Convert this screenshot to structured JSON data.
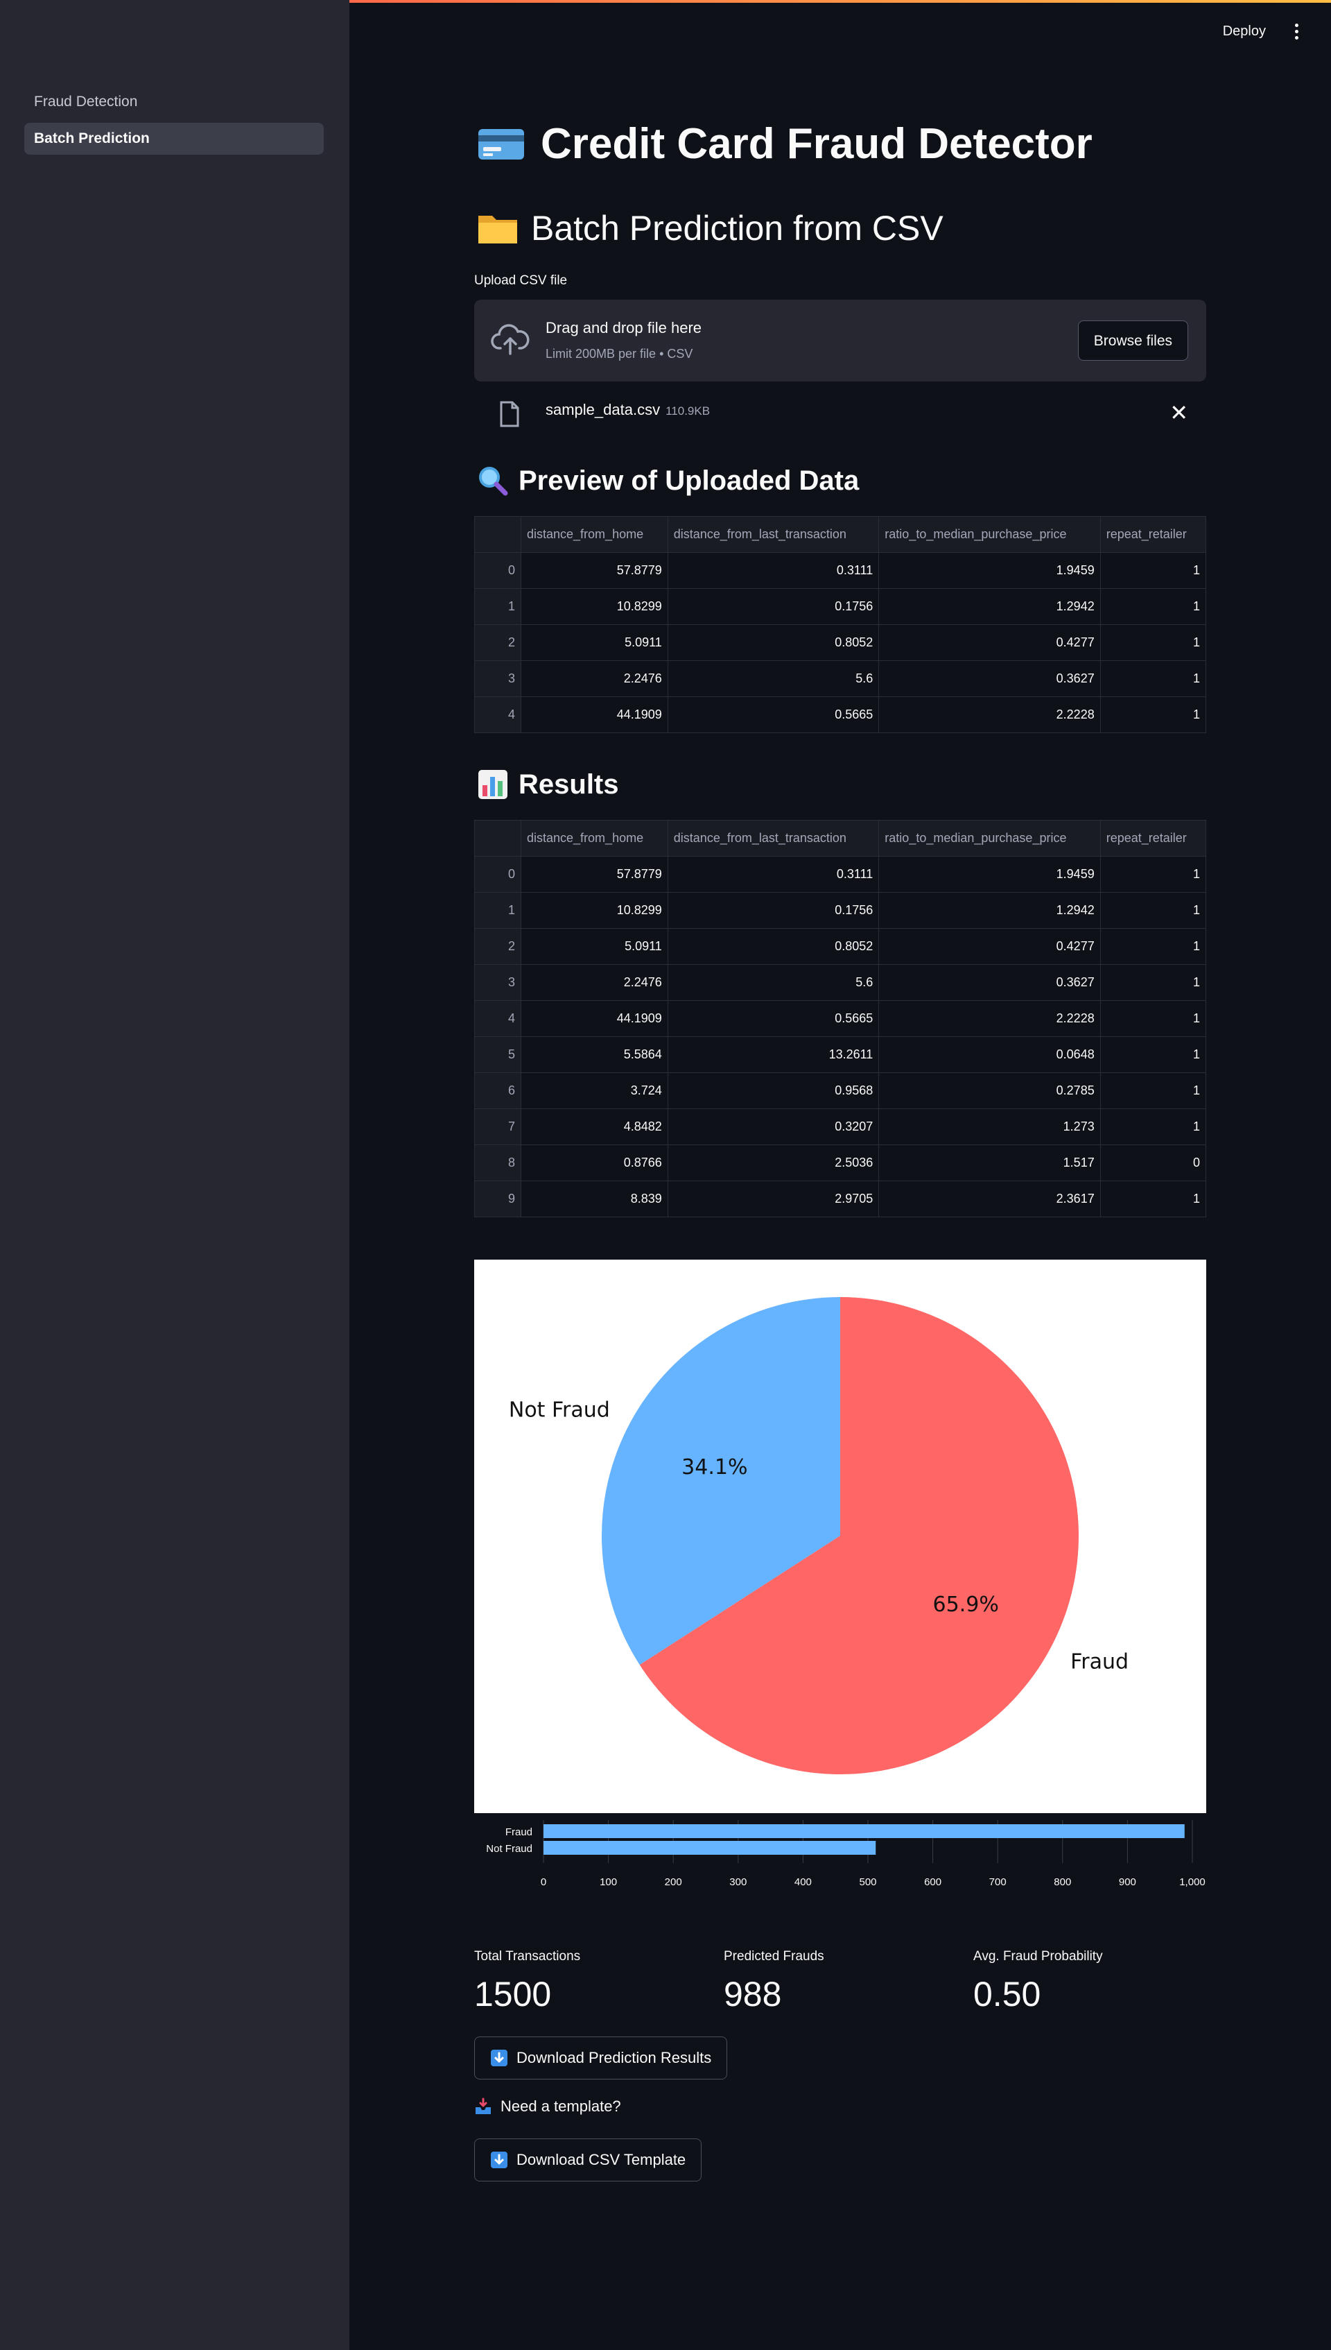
{
  "sidebar": {
    "items": [
      {
        "label": "Fraud Detection",
        "active": false
      },
      {
        "label": "Batch Prediction",
        "active": true
      }
    ]
  },
  "header": {
    "deploy_label": "Deploy",
    "menu_icon": "kebab-menu-icon"
  },
  "title": "Credit Card Fraud Detector",
  "subtitle": "Batch Prediction from CSV",
  "uploader": {
    "label": "Upload CSV file",
    "drop_text": "Drag and drop file here",
    "limit_text": "Limit 200MB per file • CSV",
    "browse_label": "Browse files",
    "file_name": "sample_data.csv",
    "file_size": "110.9KB"
  },
  "preview": {
    "heading": "Preview of Uploaded Data",
    "columns": [
      "",
      "distance_from_home",
      "distance_from_last_transaction",
      "ratio_to_median_purchase_price",
      "repeat_retailer"
    ],
    "rows": [
      [
        "0",
        "57.8779",
        "0.3111",
        "1.9459",
        "1"
      ],
      [
        "1",
        "10.8299",
        "0.1756",
        "1.2942",
        "1"
      ],
      [
        "2",
        "5.0911",
        "0.8052",
        "0.4277",
        "1"
      ],
      [
        "3",
        "2.2476",
        "5.6",
        "0.3627",
        "1"
      ],
      [
        "4",
        "44.1909",
        "0.5665",
        "2.2228",
        "1"
      ]
    ]
  },
  "results": {
    "heading": "Results",
    "columns": [
      "",
      "distance_from_home",
      "distance_from_last_transaction",
      "ratio_to_median_purchase_price",
      "repeat_retailer"
    ],
    "rows": [
      [
        "0",
        "57.8779",
        "0.3111",
        "1.9459",
        "1"
      ],
      [
        "1",
        "10.8299",
        "0.1756",
        "1.2942",
        "1"
      ],
      [
        "2",
        "5.0911",
        "0.8052",
        "0.4277",
        "1"
      ],
      [
        "3",
        "2.2476",
        "5.6",
        "0.3627",
        "1"
      ],
      [
        "4",
        "44.1909",
        "0.5665",
        "2.2228",
        "1"
      ],
      [
        "5",
        "5.5864",
        "13.2611",
        "0.0648",
        "1"
      ],
      [
        "6",
        "3.724",
        "0.9568",
        "0.2785",
        "1"
      ],
      [
        "7",
        "4.8482",
        "0.3207",
        "1.273",
        "1"
      ],
      [
        "8",
        "0.8766",
        "2.5036",
        "1.517",
        "0"
      ],
      [
        "9",
        "8.839",
        "2.9705",
        "2.3617",
        "1"
      ]
    ]
  },
  "chart_data": [
    {
      "type": "pie",
      "labels": [
        "Fraud",
        "Not Fraud"
      ],
      "values": [
        65.9,
        34.1
      ],
      "pct_labels": [
        "65.9%",
        "34.1%"
      ],
      "colors": [
        "#ff6666",
        "#66b3ff"
      ]
    },
    {
      "type": "bar",
      "orientation": "horizontal",
      "categories": [
        "Fraud",
        "Not Fraud"
      ],
      "values": [
        988,
        512
      ],
      "xlim": [
        0,
        1000
      ],
      "xticks": [
        "0",
        "100",
        "200",
        "300",
        "400",
        "500",
        "600",
        "700",
        "800",
        "900",
        "1,000"
      ],
      "color": "#66b3ff"
    }
  ],
  "metrics": [
    {
      "label": "Total Transactions",
      "value": "1500"
    },
    {
      "label": "Predicted Frauds",
      "value": "988"
    },
    {
      "label": "Avg. Fraud Probability",
      "value": "0.50"
    }
  ],
  "download_results_label": "Download Prediction Results",
  "template_prompt": "Need a template?",
  "download_template_label": "Download CSV Template"
}
